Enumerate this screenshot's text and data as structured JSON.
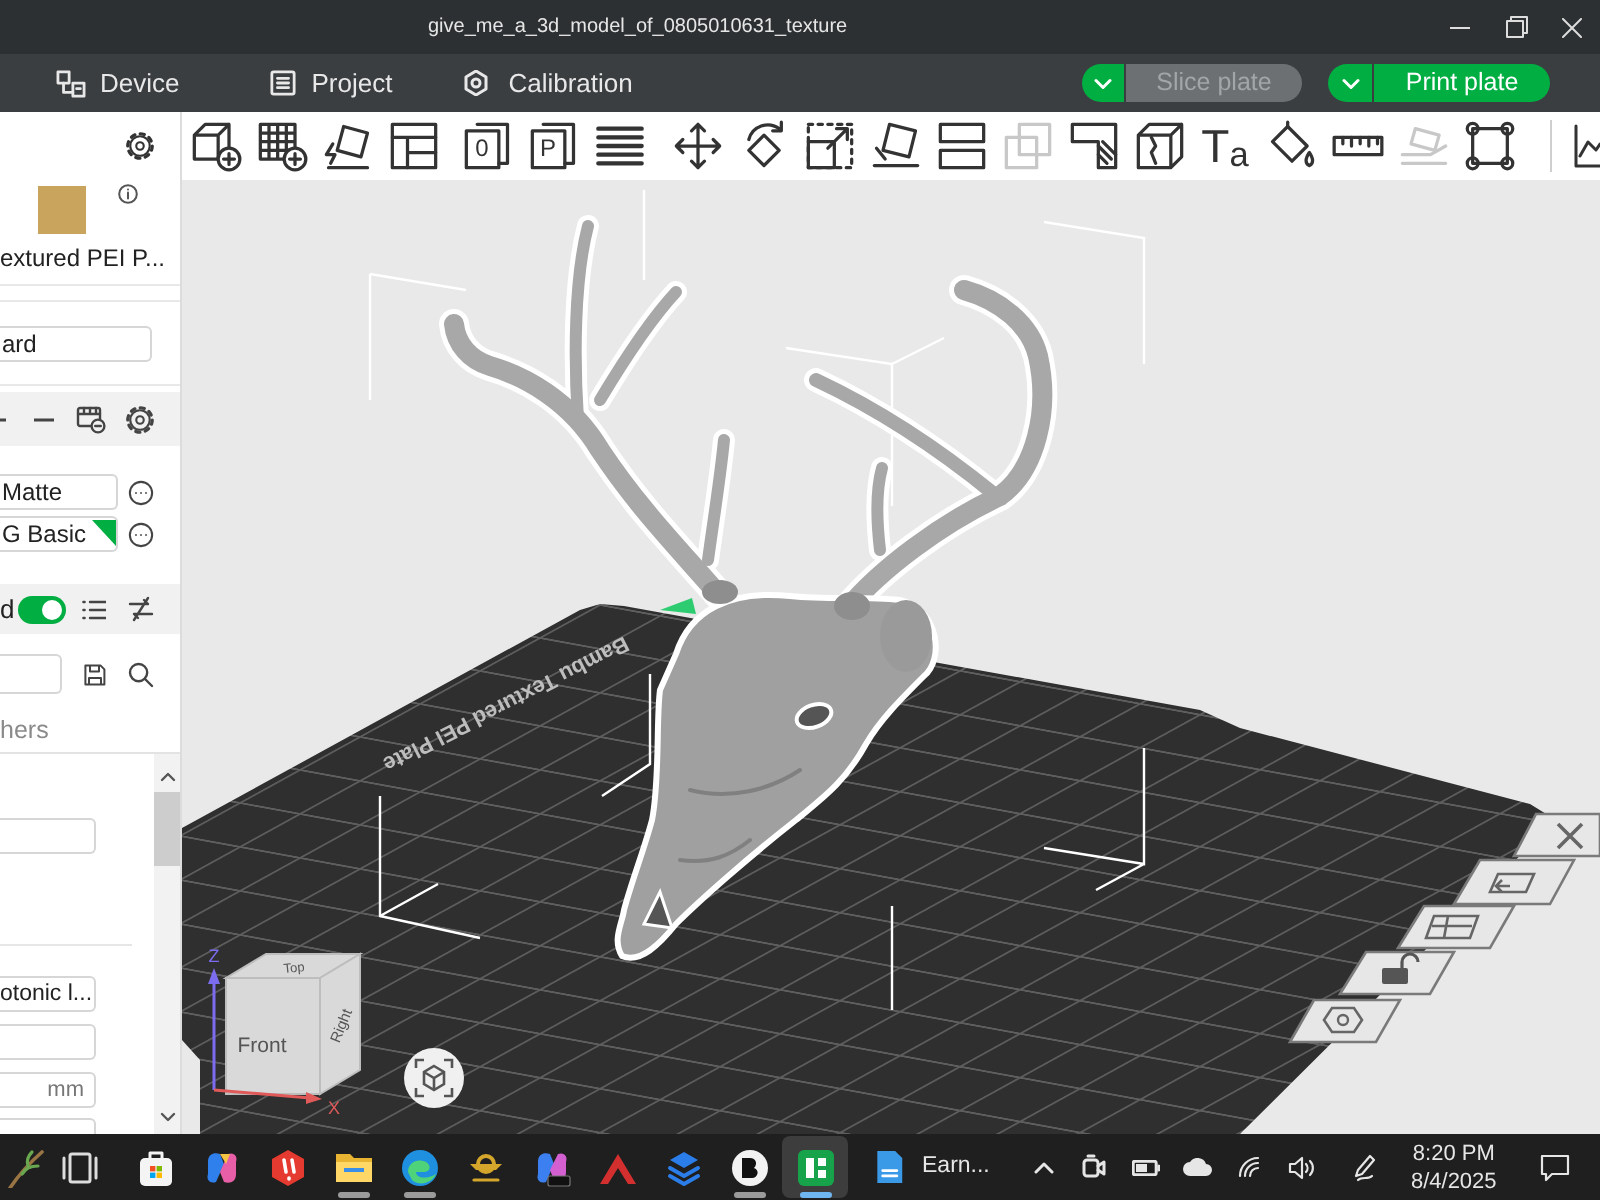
{
  "window": {
    "title": "give_me_a_3d_model_of_0805010631_texture"
  },
  "menu_tabs": [
    {
      "label": "Device",
      "selected": false
    },
    {
      "label": "Project",
      "selected": false
    },
    {
      "label": "Calibration",
      "selected": false
    }
  ],
  "actions": [
    {
      "label": "Slice plate",
      "disabled": true
    },
    {
      "label": "Print plate",
      "disabled": false
    }
  ],
  "toolbar_groups": [
    {
      "divider": false,
      "tools": [
        {
          "disabled": false
        },
        {
          "disabled": false
        },
        {
          "disabled": false
        },
        {
          "disabled": false
        }
      ]
    },
    {
      "divider": false,
      "tools": [
        {
          "disabled": false,
          "glyph": "0"
        },
        {
          "disabled": false,
          "glyph": "P"
        },
        {
          "disabled": false
        }
      ]
    },
    {
      "divider": false,
      "tools": [
        {
          "disabled": false
        },
        {
          "disabled": false
        },
        {
          "disabled": false
        },
        {
          "disabled": false
        },
        {
          "disabled": false
        },
        {
          "disabled": true
        },
        {
          "disabled": false
        },
        {
          "disabled": false
        },
        {
          "disabled": false,
          "glyph": "T$_{a}$"
        },
        {
          "disabled": false
        },
        {
          "disabled": false
        },
        {
          "disabled": true
        },
        {
          "disabled": false
        }
      ]
    },
    {
      "divider": true,
      "tools": [
        {
          "disabled": false
        }
      ]
    }
  ],
  "sidebar": {
    "plate": {
      "name": "extured PEI P..."
    },
    "printer": {
      "value": "ard"
    },
    "filaments": [
      {
        "value": "Matte",
        "corner_marker": false
      },
      {
        "value": "G Basic",
        "corner_marker": true
      }
    ],
    "process": {
      "label": "d",
      "toggle_on": true
    },
    "tab": {
      "label": "hers",
      "selected": false
    },
    "params": [
      {
        "value": "otonic l..."
      },
      {
        "unit": "mm"
      }
    ]
  },
  "viewport": {
    "plate_label": "Bambu Textured PEI Plate",
    "view_cube": {
      "faces": [
        "Top",
        "Front",
        "Right"
      ],
      "axes": [
        "Z",
        "X"
      ]
    }
  },
  "taskbar": {
    "apps": [
      {
        "running": false,
        "active": false
      },
      {
        "running": false,
        "active": false
      },
      {
        "running": false,
        "active": false
      },
      {
        "running": false,
        "active": false
      },
      {
        "running": false,
        "active": false
      },
      {
        "running": true,
        "active": false
      },
      {
        "running": true,
        "active": false
      },
      {
        "running": false,
        "active": false
      },
      {
        "running": false,
        "active": false
      },
      {
        "running": false,
        "active": false
      },
      {
        "running": false,
        "active": false
      },
      {
        "running": true,
        "active": false
      },
      {
        "running": true,
        "active": true
      }
    ],
    "window_button": {
      "label": "Earn..."
    },
    "clock": {
      "time": "8:20 PM",
      "date": "8/4/2025"
    }
  }
}
